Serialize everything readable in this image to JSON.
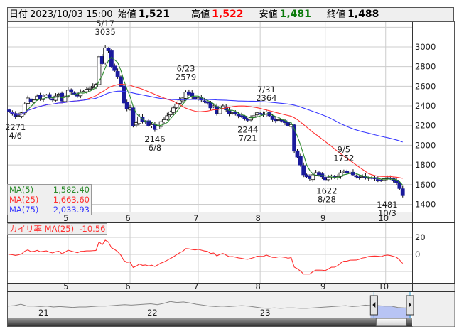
{
  "header": {
    "date_label": "日付",
    "date": "2023/10/03 15:00",
    "open_label": "始値",
    "open": "1,521",
    "high_label": "高値",
    "high": "1,522",
    "low_label": "安値",
    "low": "1,481",
    "close_label": "終値",
    "close": "1,488"
  },
  "legend": {
    "ma5": {
      "label": "MA(5)",
      "value": "1,582.40",
      "color": "#2a8a2a"
    },
    "ma25": {
      "label": "MA(25)",
      "value": "1,663.60",
      "color": "#ff3030"
    },
    "ma75": {
      "label": "MA(75)",
      "value": "2,033.93",
      "color": "#3a3aff"
    }
  },
  "osc_legend": {
    "label": "カイリ率 MA(25)",
    "value": "-10.56",
    "color": "#ff3030"
  },
  "chart_data": {
    "type": "candlestick",
    "title": "",
    "closes": [
      2340,
      2320,
      2290,
      2300,
      2330,
      2420,
      2480,
      2440,
      2460,
      2500,
      2470,
      2490,
      2510,
      2480,
      2460,
      2500,
      2520,
      2450,
      2500,
      2560,
      2540,
      2520,
      2500,
      2540,
      2550,
      2570,
      2580,
      2600,
      2620,
      2900,
      2830,
      2990,
      2960,
      2800,
      2760,
      2700,
      2600,
      2430,
      2370,
      2380,
      2200,
      2230,
      2290,
      2240,
      2240,
      2200,
      2210,
      2160,
      2200,
      2240,
      2260,
      2300,
      2340,
      2380,
      2420,
      2460,
      2480,
      2540,
      2520,
      2490,
      2470,
      2480,
      2460,
      2440,
      2430,
      2380,
      2400,
      2320,
      2370,
      2400,
      2360,
      2320,
      2330,
      2320,
      2300,
      2290,
      2270,
      2260,
      2280,
      2300,
      2330,
      2320,
      2310,
      2340,
      2300,
      2260,
      2250,
      2260,
      2250,
      2230,
      2200,
      2210,
      1940,
      1880,
      1800,
      1700,
      1680,
      1660,
      1700,
      1720,
      1700,
      1680,
      1650,
      1670,
      1690,
      1670,
      1680,
      1720,
      1740,
      1720,
      1720,
      1700,
      1680,
      1675,
      1680,
      1670,
      1670,
      1665,
      1660,
      1650,
      1640,
      1660,
      1670,
      1660,
      1640,
      1620,
      1560,
      1488
    ],
    "first_open": 2360,
    "y_ticks": [
      1400,
      1600,
      1800,
      2000,
      2200,
      2400,
      2600,
      2800,
      3000
    ],
    "y_range": [
      1330,
      3253
    ],
    "x_ticks": [
      {
        "label": "5",
        "index": 19
      },
      {
        "label": "6",
        "index": 39
      },
      {
        "label": "7",
        "index": 61
      },
      {
        "label": "8",
        "index": 81
      },
      {
        "label": "9",
        "index": 102
      },
      {
        "label": "10",
        "index": 121.5
      }
    ],
    "annotations": [
      {
        "date": "5/17",
        "value": "3035",
        "index": 31,
        "price": 3035,
        "pos": "above"
      },
      {
        "date": "4/6",
        "value": "2271",
        "index": 2,
        "price": 2271,
        "pos": "below"
      },
      {
        "date": "6/8",
        "value": "2146",
        "index": 47,
        "price": 2146,
        "pos": "below"
      },
      {
        "date": "6/23",
        "value": "2579",
        "index": 57,
        "price": 2579,
        "pos": "above"
      },
      {
        "date": "7/21",
        "value": "2244",
        "index": 77,
        "price": 2244,
        "pos": "below"
      },
      {
        "date": "7/31",
        "value": "2364",
        "index": 83,
        "price": 2364,
        "pos": "above"
      },
      {
        "date": "8/28",
        "value": "1622",
        "index": 102.5,
        "price": 1622,
        "pos": "below"
      },
      {
        "date": "9/5",
        "value": "1752",
        "index": 108,
        "price": 1752,
        "pos": "above"
      },
      {
        "date": "10/3",
        "value": "1481",
        "index": 122,
        "price": 1481,
        "pos": "below"
      }
    ],
    "osc_ticks": [
      20,
      0
    ],
    "navigator": {
      "years": [
        {
          "label": "21",
          "pos": 0.09
        },
        {
          "label": "22",
          "pos": 0.36
        },
        {
          "label": "23",
          "pos": 0.64
        }
      ],
      "values": [
        2300,
        2350,
        2500,
        2300,
        2300,
        2250,
        2300,
        2200,
        2250,
        2200,
        2150,
        2200,
        2200,
        2250,
        2300,
        2300,
        2350,
        2400,
        2450,
        2400,
        2450,
        2500,
        2550,
        2450,
        2600,
        2800,
        2700,
        2750,
        2650,
        2500,
        2400,
        2300,
        2250,
        2300,
        2250,
        2300,
        2350,
        2300,
        2200,
        2100,
        2050,
        2100,
        2050,
        2100,
        2100,
        2050,
        2050,
        2100,
        2150,
        2200,
        2250,
        2300,
        2350,
        2250,
        2300,
        2400,
        2350,
        2350,
        2300,
        2300,
        2150,
        2100,
        2100
      ],
      "selection_start": 0.9
    }
  }
}
